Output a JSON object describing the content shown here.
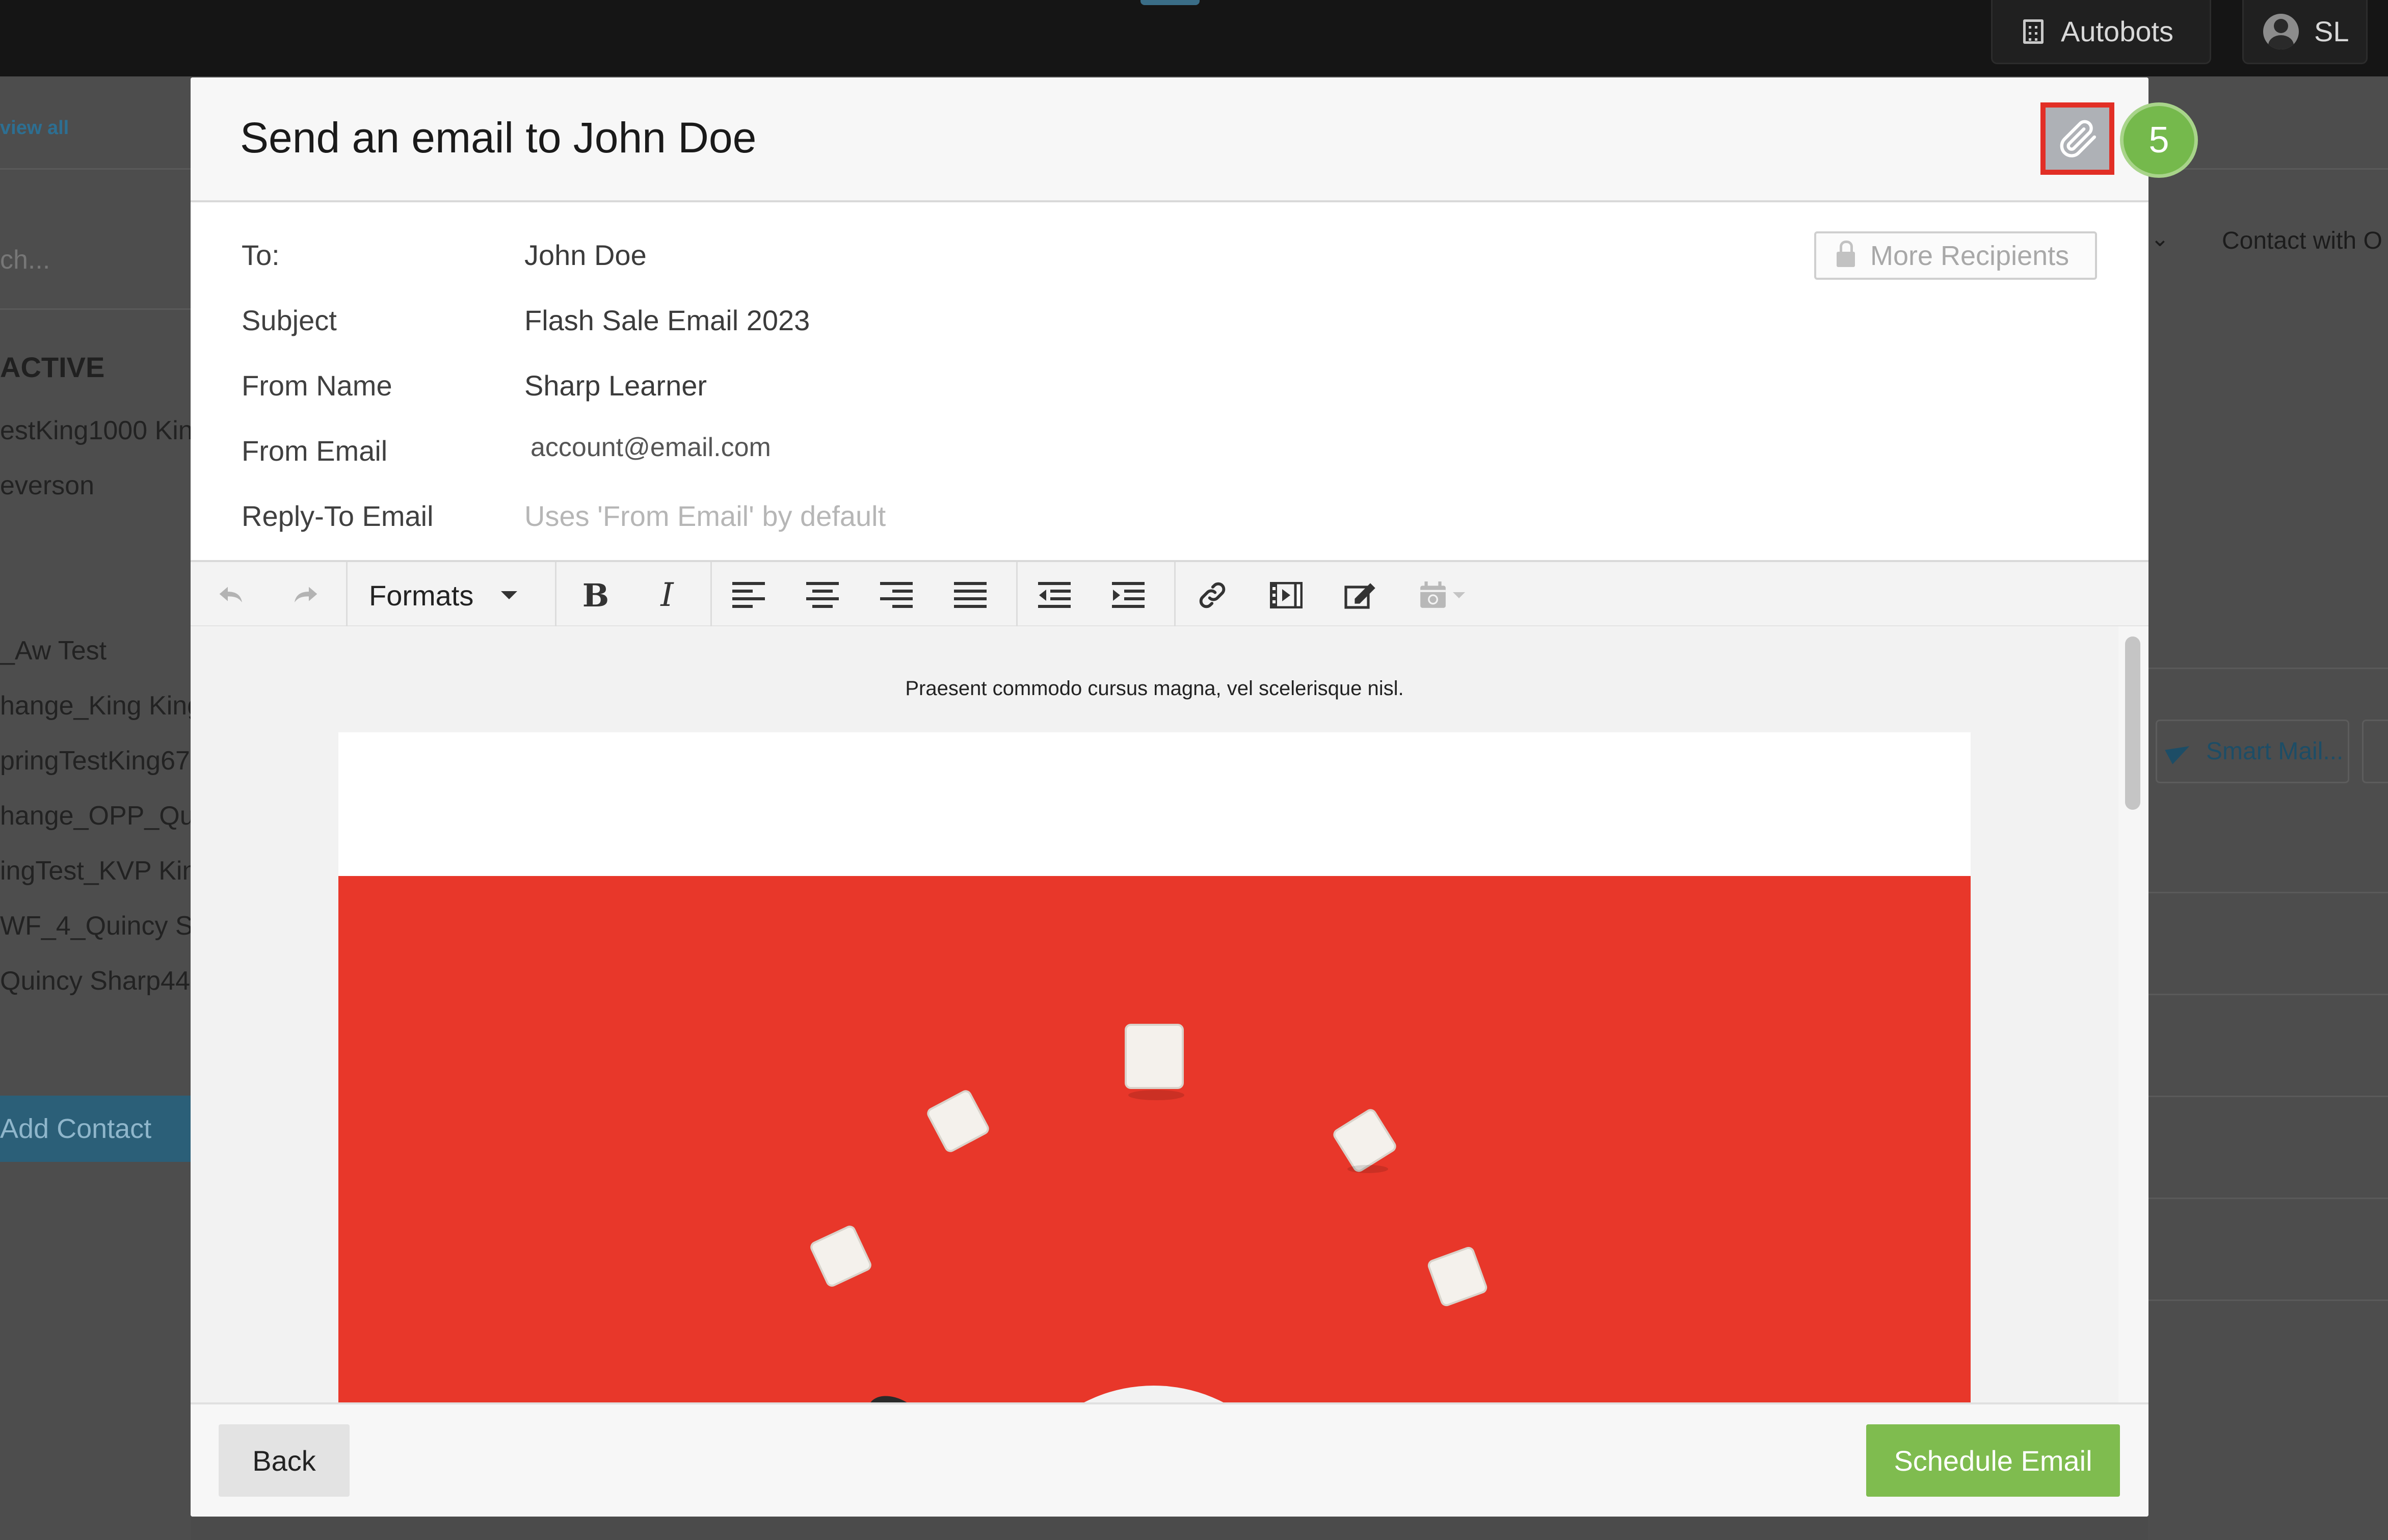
{
  "topbar": {
    "org_name": "Autobots",
    "user_initials": "SL"
  },
  "background_left": {
    "view_all": "view all",
    "search_placeholder": "ch...",
    "section_heading": "ACTIVE",
    "items_top": [
      "estKing1000 King",
      "everson"
    ],
    "items_bottom": [
      "_Aw Test",
      "hange_King King",
      "pringTestKing67",
      "hange_OPP_Qui",
      "ingTest_KVP King",
      "WF_4_Quincy Sh",
      "Quincy Sharp44"
    ],
    "add_contact": "Add Contact"
  },
  "background_right": {
    "contact_with": "Contact with O",
    "smart_mail": "Smart Mail..."
  },
  "modal": {
    "title": "Send an email to John Doe",
    "step_badge": "5",
    "fields": {
      "to_label": "To:",
      "to_value": "John Doe",
      "subject_label": "Subject",
      "subject_value": "Flash Sale Email 2023",
      "from_name_label": "From Name",
      "from_name_value": "Sharp Learner",
      "from_email_label": "From Email",
      "from_email_value": "account@email.com",
      "reply_to_label": "Reply-To Email",
      "reply_to_placeholder": "Uses 'From Email' by default"
    },
    "more_recipients": "More Recipients",
    "toolbar": {
      "formats_label": "Formats"
    },
    "editor": {
      "preheader": "Praesent commodo cursus magna, vel scelerisque nisl."
    },
    "footer": {
      "back_label": "Back",
      "schedule_label": "Schedule Email"
    }
  },
  "colors": {
    "accent_green": "#7fbc4f",
    "highlight_red": "#e22f26",
    "hero_red": "#e8372a"
  }
}
